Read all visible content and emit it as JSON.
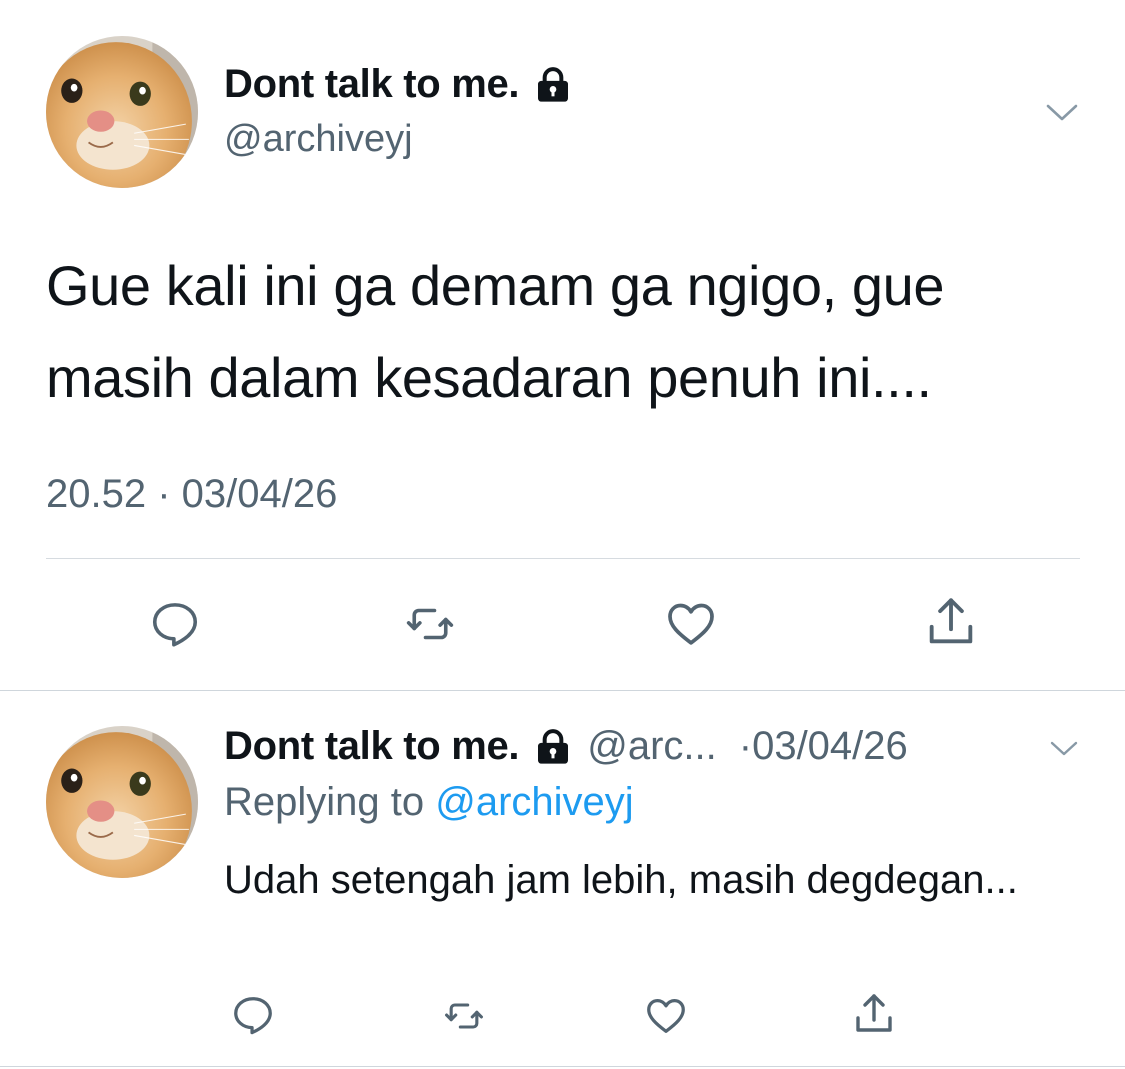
{
  "main_tweet": {
    "display_name": "Dont talk to me.",
    "handle": "@archiveyj",
    "text": "Gue kali ini ga demam ga ngigo, gue masih dalam kesadaran penuh ini....",
    "timestamp": "20.52 · 03/04/26",
    "actions": [
      "reply-icon",
      "retweet-icon",
      "like-icon",
      "share-icon"
    ]
  },
  "reply_tweet": {
    "display_name": "Dont talk to me.",
    "handle": "@arc...",
    "time": "·03/04/26",
    "replying_prefix": "Replying to ",
    "replying_to": "@archiveyj",
    "text": "Udah setengah jam lebih, masih degdegan...",
    "actions": [
      "reply-icon",
      "retweet-icon",
      "like-icon",
      "share-icon"
    ]
  },
  "colors": {
    "text": "#0f1419",
    "secondary": "#536471",
    "link": "#1d9bf0",
    "divider": "#d6dbe0"
  }
}
